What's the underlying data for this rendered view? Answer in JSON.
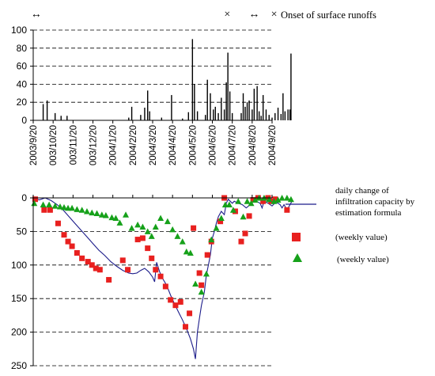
{
  "runoff_legend": {
    "onset_label": "Onset of surface runoffs"
  },
  "legend": {
    "line_label_lines": [
      "daily change of",
      "infiltration capacity by",
      "estimation formula"
    ],
    "square_label": "(weekly value)",
    "triangle_label": "(weekly value)"
  },
  "colors": {
    "line": "#1c1c8a",
    "square": "#e8201f",
    "triangle": "#16a11a",
    "bars": "#000000"
  },
  "chart_data": [
    {
      "type": "bar",
      "ylim": [
        0,
        100
      ],
      "yticks": [
        0,
        20,
        40,
        60,
        80,
        100
      ],
      "grid": "dashed horizontal",
      "x_tick_labels": [
        "2003/9/20",
        "2003/10/20",
        "2003/11/20",
        "2003/12/20",
        "2004/1/20",
        "2004/2/20",
        "2004/3/20",
        "2004/4/20",
        "2004/5/20",
        "2004/6/20",
        "2004/7/20",
        "2004/8/20",
        "2004/9/20"
      ],
      "x_tick_labels_display": [
        "2003/9/20",
        "003/10/20",
        "003/11/20",
        "003/12/20",
        "2004/1/20",
        "2004/2/20",
        "2004/3/20",
        "2004/4/20",
        "2004/5/20",
        "2004/6/20",
        "2004/7/20",
        "2004/8/20",
        "2004/9/20"
      ],
      "bars": [
        {
          "x": 0.5,
          "y": 18
        },
        {
          "x": 0.7,
          "y": 22
        },
        {
          "x": 1.1,
          "y": 8
        },
        {
          "x": 1.4,
          "y": 5
        },
        {
          "x": 1.7,
          "y": 5
        },
        {
          "x": 4.8,
          "y": 3
        },
        {
          "x": 4.95,
          "y": 15
        },
        {
          "x": 5.4,
          "y": 6
        },
        {
          "x": 5.6,
          "y": 14
        },
        {
          "x": 5.75,
          "y": 33
        },
        {
          "x": 5.85,
          "y": 10
        },
        {
          "x": 6.45,
          "y": 3
        },
        {
          "x": 6.95,
          "y": 28
        },
        {
          "x": 7.5,
          "y": 2
        },
        {
          "x": 7.8,
          "y": 9
        },
        {
          "x": 8.0,
          "y": 90
        },
        {
          "x": 8.1,
          "y": 40
        },
        {
          "x": 8.25,
          "y": 10
        },
        {
          "x": 8.65,
          "y": 6
        },
        {
          "x": 8.75,
          "y": 45
        },
        {
          "x": 8.9,
          "y": 30
        },
        {
          "x": 9.05,
          "y": 12
        },
        {
          "x": 9.15,
          "y": 15
        },
        {
          "x": 9.3,
          "y": 8
        },
        {
          "x": 9.45,
          "y": 25
        },
        {
          "x": 9.6,
          "y": 12
        },
        {
          "x": 9.7,
          "y": 42
        },
        {
          "x": 9.78,
          "y": 75
        },
        {
          "x": 9.88,
          "y": 32
        },
        {
          "x": 10.0,
          "y": 8
        },
        {
          "x": 10.45,
          "y": 8
        },
        {
          "x": 10.55,
          "y": 30
        },
        {
          "x": 10.65,
          "y": 15
        },
        {
          "x": 10.75,
          "y": 20
        },
        {
          "x": 10.85,
          "y": 22
        },
        {
          "x": 11.0,
          "y": 12
        },
        {
          "x": 11.1,
          "y": 35
        },
        {
          "x": 11.25,
          "y": 38
        },
        {
          "x": 11.35,
          "y": 10
        },
        {
          "x": 11.45,
          "y": 5
        },
        {
          "x": 11.55,
          "y": 28
        },
        {
          "x": 11.7,
          "y": 12
        },
        {
          "x": 11.85,
          "y": 6
        },
        {
          "x": 12.0,
          "y": 3
        },
        {
          "x": 12.15,
          "y": 8
        },
        {
          "x": 12.3,
          "y": 14
        },
        {
          "x": 12.45,
          "y": 7
        },
        {
          "x": 12.55,
          "y": 30
        },
        {
          "x": 12.65,
          "y": 10
        },
        {
          "x": 12.8,
          "y": 12
        },
        {
          "x": 12.9,
          "y": 12
        },
        {
          "x": 12.95,
          "y": 74
        }
      ],
      "runoff_markers": [
        {
          "symbol": "↔",
          "x": 0.15
        },
        {
          "symbol": "×",
          "x": 9.75
        },
        {
          "symbol": "↔",
          "x": 11.1
        },
        {
          "symbol": "×",
          "x": 12.1
        }
      ]
    },
    {
      "type": "line",
      "ylim": [
        0,
        250
      ],
      "y_inverted": true,
      "yticks": [
        0,
        50,
        100,
        150,
        200,
        250
      ],
      "grid": "dashed horizontal",
      "series": [
        {
          "kind": "line",
          "points": [
            [
              0.0,
              0
            ],
            [
              0.3,
              3
            ],
            [
              0.6,
              0
            ],
            [
              0.9,
              4
            ],
            [
              1.2,
              10
            ],
            [
              1.5,
              18
            ],
            [
              1.8,
              28
            ],
            [
              2.1,
              38
            ],
            [
              2.4,
              48
            ],
            [
              2.7,
              58
            ],
            [
              3.0,
              68
            ],
            [
              3.3,
              78
            ],
            [
              3.6,
              86
            ],
            [
              3.9,
              95
            ],
            [
              4.2,
              102
            ],
            [
              4.5,
              108
            ],
            [
              4.8,
              112
            ],
            [
              5.0,
              113
            ],
            [
              5.2,
              112
            ],
            [
              5.4,
              108
            ],
            [
              5.6,
              105
            ],
            [
              5.8,
              110
            ],
            [
              6.0,
              118
            ],
            [
              6.1,
              125
            ],
            [
              6.2,
              96
            ],
            [
              6.35,
              110
            ],
            [
              6.5,
              120
            ],
            [
              6.7,
              130
            ],
            [
              6.9,
              145
            ],
            [
              7.1,
              158
            ],
            [
              7.3,
              170
            ],
            [
              7.5,
              182
            ],
            [
              7.7,
              195
            ],
            [
              7.9,
              210
            ],
            [
              8.05,
              225
            ],
            [
              8.15,
              240
            ],
            [
              8.25,
              200
            ],
            [
              8.35,
              180
            ],
            [
              8.45,
              160
            ],
            [
              8.6,
              140
            ],
            [
              8.7,
              115
            ],
            [
              8.8,
              100
            ],
            [
              8.9,
              85
            ],
            [
              9.0,
              60
            ],
            [
              9.1,
              50
            ],
            [
              9.2,
              38
            ],
            [
              9.3,
              28
            ],
            [
              9.45,
              20
            ],
            [
              9.6,
              25
            ],
            [
              9.7,
              8
            ],
            [
              9.8,
              2
            ],
            [
              9.9,
              5
            ],
            [
              10.0,
              8
            ],
            [
              10.1,
              5
            ],
            [
              10.3,
              8
            ],
            [
              10.5,
              10
            ],
            [
              10.7,
              15
            ],
            [
              10.9,
              10
            ],
            [
              11.0,
              2
            ],
            [
              11.2,
              5
            ],
            [
              11.4,
              8
            ],
            [
              11.5,
              15
            ],
            [
              11.6,
              5
            ],
            [
              11.8,
              8
            ],
            [
              12.0,
              12
            ],
            [
              12.2,
              6
            ],
            [
              12.4,
              10
            ],
            [
              12.5,
              15
            ],
            [
              12.6,
              10
            ],
            [
              12.75,
              18
            ],
            [
              12.9,
              10
            ],
            [
              13.0,
              5
            ]
          ]
        },
        {
          "kind": "square",
          "points": [
            [
              0.1,
              2
            ],
            [
              0.55,
              18
            ],
            [
              0.85,
              18
            ],
            [
              1.25,
              38
            ],
            [
              1.55,
              55
            ],
            [
              1.75,
              65
            ],
            [
              1.95,
              72
            ],
            [
              2.2,
              82
            ],
            [
              2.45,
              90
            ],
            [
              2.75,
              95
            ],
            [
              2.95,
              100
            ],
            [
              3.15,
              105
            ],
            [
              3.35,
              107
            ],
            [
              3.8,
              122
            ],
            [
              4.5,
              93
            ],
            [
              4.75,
              107
            ],
            [
              5.25,
              62
            ],
            [
              5.5,
              60
            ],
            [
              5.75,
              75
            ],
            [
              5.95,
              90
            ],
            [
              6.15,
              107
            ],
            [
              6.4,
              117
            ],
            [
              6.65,
              132
            ],
            [
              6.9,
              152
            ],
            [
              7.15,
              160
            ],
            [
              7.4,
              155
            ],
            [
              7.65,
              192
            ],
            [
              7.85,
              172
            ],
            [
              8.05,
              45
            ],
            [
              8.35,
              112
            ],
            [
              8.45,
              130
            ],
            [
              8.75,
              85
            ],
            [
              8.95,
              65
            ],
            [
              9.4,
              35
            ],
            [
              9.6,
              0
            ],
            [
              10.15,
              20
            ],
            [
              10.45,
              65
            ],
            [
              10.65,
              53
            ],
            [
              10.85,
              27
            ],
            [
              11.05,
              3
            ],
            [
              11.3,
              0
            ],
            [
              11.55,
              5
            ],
            [
              11.8,
              0
            ],
            [
              11.95,
              5
            ],
            [
              12.15,
              2
            ],
            [
              12.75,
              18
            ]
          ]
        },
        {
          "kind": "triangle",
          "points": [
            [
              0.05,
              8
            ],
            [
              0.5,
              10
            ],
            [
              0.8,
              10
            ],
            [
              1.1,
              12
            ],
            [
              1.35,
              13
            ],
            [
              1.55,
              14
            ],
            [
              1.75,
              15
            ],
            [
              1.95,
              15
            ],
            [
              2.2,
              17
            ],
            [
              2.45,
              18
            ],
            [
              2.7,
              20
            ],
            [
              2.95,
              22
            ],
            [
              3.2,
              23
            ],
            [
              3.45,
              25
            ],
            [
              3.65,
              26
            ],
            [
              3.95,
              29
            ],
            [
              4.15,
              30
            ],
            [
              4.35,
              37
            ],
            [
              4.65,
              25
            ],
            [
              4.95,
              45
            ],
            [
              5.25,
              40
            ],
            [
              5.5,
              43
            ],
            [
              5.75,
              50
            ],
            [
              5.95,
              57
            ],
            [
              6.15,
              43
            ],
            [
              6.4,
              30
            ],
            [
              6.75,
              35
            ],
            [
              7.0,
              47
            ],
            [
              7.25,
              57
            ],
            [
              7.5,
              65
            ],
            [
              7.7,
              80
            ],
            [
              7.9,
              82
            ],
            [
              8.15,
              128
            ],
            [
              8.45,
              140
            ],
            [
              8.7,
              113
            ],
            [
              8.95,
              62
            ],
            [
              9.2,
              45
            ],
            [
              9.45,
              30
            ],
            [
              9.65,
              10
            ],
            [
              9.85,
              10
            ],
            [
              10.05,
              18
            ],
            [
              10.3,
              5
            ],
            [
              10.55,
              28
            ],
            [
              10.75,
              5
            ],
            [
              10.95,
              8
            ],
            [
              11.15,
              3
            ],
            [
              11.35,
              0
            ],
            [
              11.6,
              0
            ],
            [
              11.85,
              2
            ],
            [
              12.1,
              5
            ],
            [
              12.3,
              3
            ],
            [
              12.5,
              0
            ],
            [
              12.75,
              0
            ],
            [
              12.95,
              2
            ]
          ]
        }
      ]
    }
  ]
}
